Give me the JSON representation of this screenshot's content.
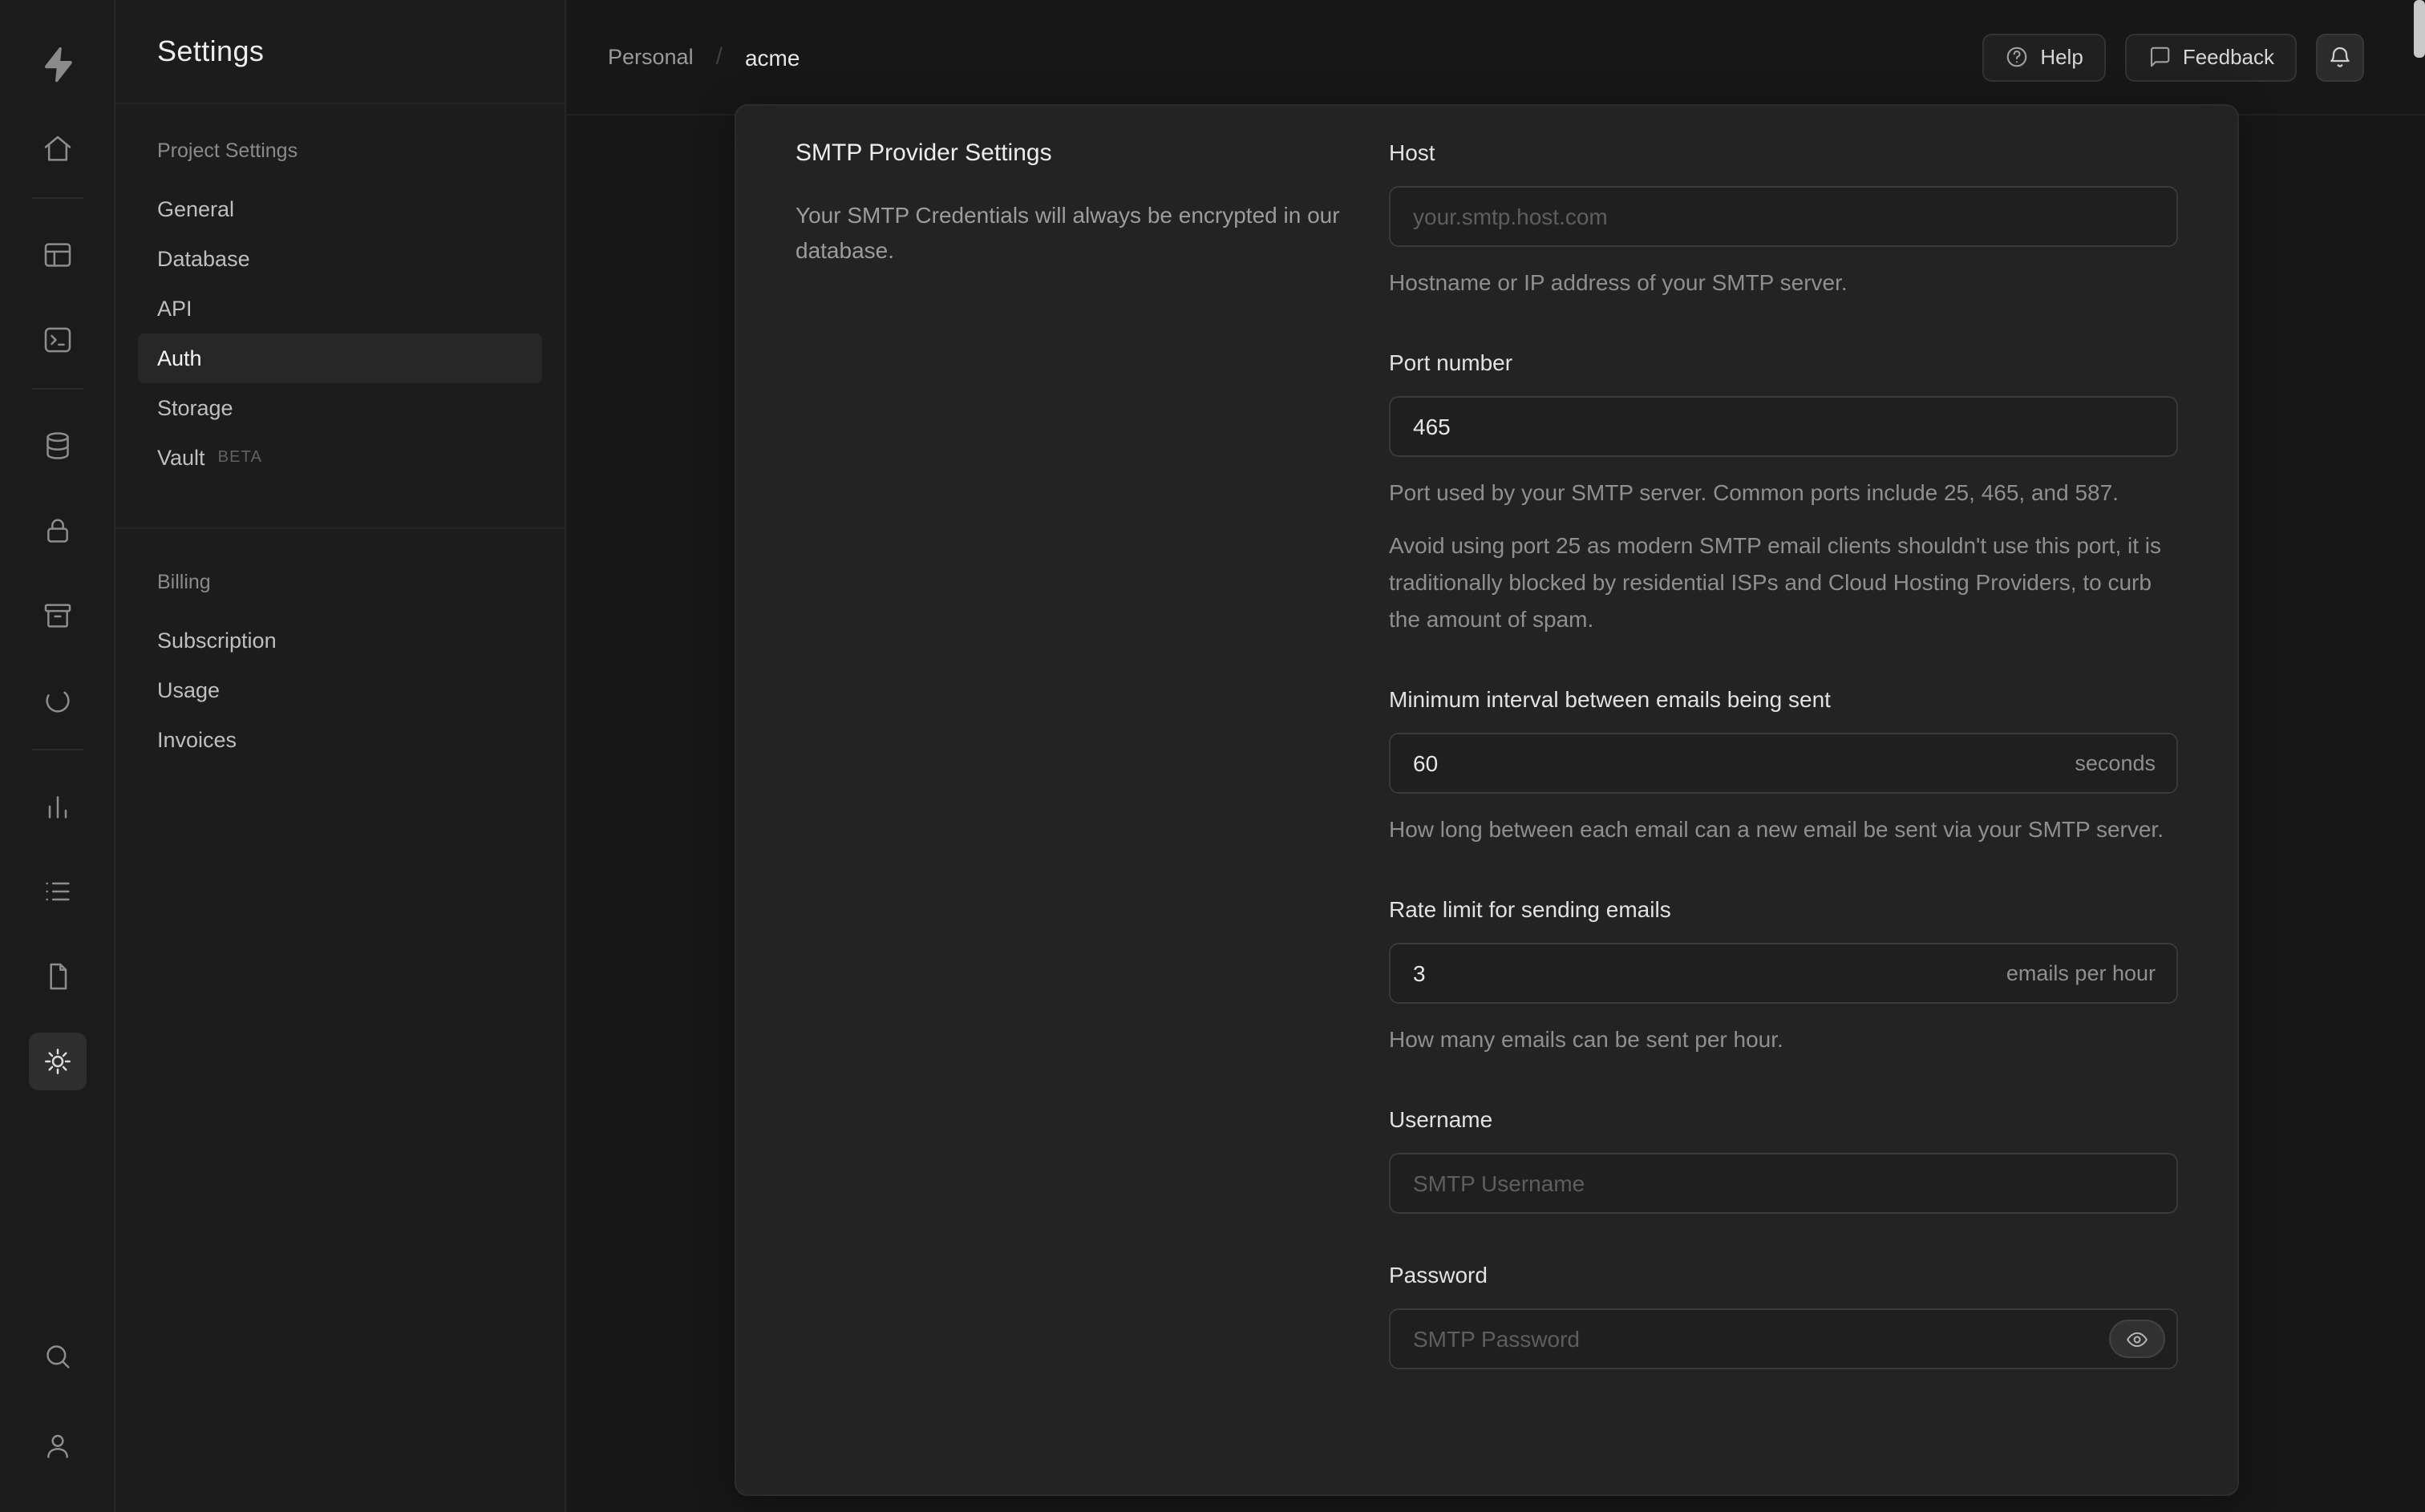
{
  "rail": {
    "icons": [
      "supabase-logo",
      "home",
      "table-editor",
      "sql-editor",
      "database",
      "auth",
      "storage",
      "edge-functions",
      "reports",
      "logs",
      "docs",
      "settings",
      "search",
      "user"
    ],
    "active": "settings"
  },
  "sidebar": {
    "title": "Settings",
    "project_section": {
      "header": "Project Settings",
      "items": [
        {
          "label": "General"
        },
        {
          "label": "Database"
        },
        {
          "label": "API"
        },
        {
          "label": "Auth"
        },
        {
          "label": "Storage"
        },
        {
          "label": "Vault",
          "badge": "BETA"
        }
      ],
      "active_item": "Auth"
    },
    "billing_section": {
      "header": "Billing",
      "items": [
        {
          "label": "Subscription"
        },
        {
          "label": "Usage"
        },
        {
          "label": "Invoices"
        }
      ]
    }
  },
  "header": {
    "breadcrumb": {
      "org": "Personal",
      "separator": "/",
      "project": "acme"
    },
    "help_button": "Help",
    "feedback_button": "Feedback"
  },
  "panel": {
    "title": "SMTP Provider Settings",
    "description": "Your SMTP Credentials will always be encrypted in our database.",
    "host": {
      "label": "Host",
      "placeholder": "your.smtp.host.com",
      "help": "Hostname or IP address of your SMTP server."
    },
    "port": {
      "label": "Port number",
      "value": "465",
      "help": "Port used by your SMTP server. Common ports include 25, 465, and 587.",
      "note": "Avoid using port 25 as modern SMTP email clients shouldn't use this port, it is traditionally blocked by residential ISPs and Cloud Hosting Providers, to curb the amount of spam."
    },
    "interval": {
      "label": "Minimum interval between emails being sent",
      "value": "60",
      "suffix": "seconds",
      "help": "How long between each email can a new email be sent via your SMTP server."
    },
    "rate": {
      "label": "Rate limit for sending emails",
      "value": "3",
      "suffix": "emails per hour",
      "help": "How many emails can be sent per hour."
    },
    "username": {
      "label": "Username",
      "placeholder": "SMTP Username"
    },
    "password": {
      "label": "Password",
      "placeholder": "SMTP Password"
    }
  },
  "colors": {
    "background": "#171717",
    "sidebar": "#1c1c1c",
    "panel": "#232323",
    "border": "#2c2c2c",
    "text_primary": "#ededed",
    "text_muted": "#8f8f8f"
  }
}
